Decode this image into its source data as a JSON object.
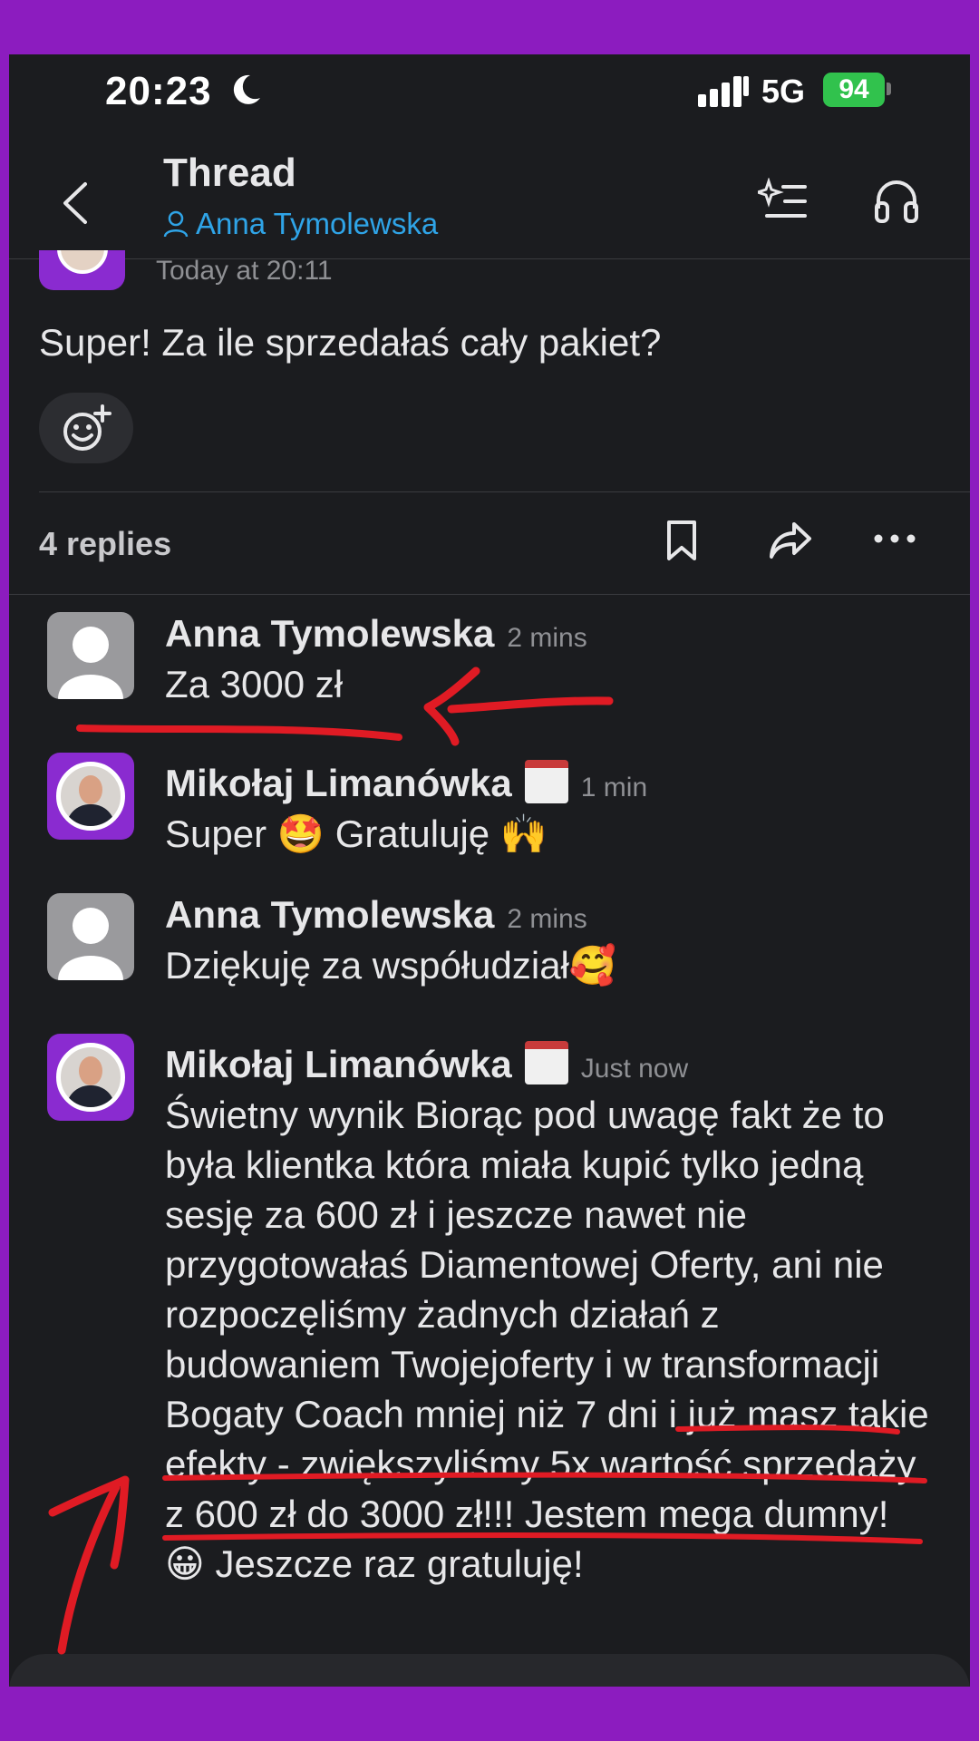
{
  "status": {
    "time": "20:23",
    "network": "5G",
    "battery": "94"
  },
  "header": {
    "title": "Thread",
    "subtitle": "Anna Tymolewska"
  },
  "parent": {
    "timestamp": "Today at 20:11",
    "text": "Super! Za ile sprzedałaś cały pakiet?"
  },
  "replies": {
    "count_label": "4 replies"
  },
  "messages": [
    {
      "name": "Anna Tymolewska",
      "time": "2 mins",
      "text": "Za 3000 zł"
    },
    {
      "name": "Mikołaj Limanówka",
      "time": "1 min",
      "text": "Super 🤩 Gratuluję 🙌"
    },
    {
      "name": "Anna Tymolewska",
      "time": "2 mins",
      "text": "Dziękuję za współudział🥰"
    },
    {
      "name": "Mikołaj Limanówka",
      "time": "Just now",
      "text": "Świetny wynik Biorąc pod uwagę fakt że to była klientka która miała kupić tylko jedną sesję za 600 zł i jeszcze nawet nie przygotowałaś Diamentowej Oferty, ani nie rozpoczęliśmy żadnych działań z budowaniem Twojejoferty i w transformacji Bogaty Coach mniej niż 7 dni i już masz takie efekty - zwiększyliśmy 5x wartość sprzedaży z 600 zł do 3000 zł!!! Jestem mega dumny! 😀 Jeszcze raz gratuluję!"
    }
  ],
  "colors": {
    "page_border": "#8c1cbf",
    "background": "#1b1c1f",
    "link": "#2fa4e7",
    "annotation": "#e01b24"
  },
  "icons": [
    "moon-icon",
    "back-arrow-icon",
    "user-icon",
    "ai-sparkle-list-icon",
    "headphones-icon",
    "add-reaction-icon",
    "bookmark-icon",
    "share-icon",
    "more-icon",
    "calendar-emoji"
  ]
}
